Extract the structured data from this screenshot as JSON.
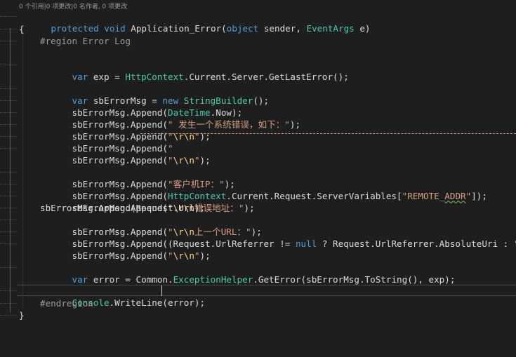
{
  "codelens": {
    "text": "0 个引用|0 项更改|0 名作者, 0 项更改"
  },
  "lines": {
    "l1": {
      "kw1": "protected",
      "kw2": "void",
      "name": " Application_Error(",
      "kw3": "object",
      "p1": " sender, ",
      "ty1": "EventArgs",
      "p2": " e)"
    },
    "l2": {
      "text": "{"
    },
    "l3": {
      "text": "#region Error Log"
    },
    "l4": {
      "kw": "var",
      "p1": " exp = ",
      "ty": "HttpContext",
      "p2": ".Current.Server.GetLastError();"
    },
    "l5": {
      "kw": "var",
      "p1": " sbErrorMsg = ",
      "kw2": "new",
      "sp": " ",
      "ty": "StringBuilder",
      "p2": "();"
    },
    "l6": {
      "p1": "sbErrorMsg.Append(",
      "ty": "DateTime",
      "p2": ".Now);"
    },
    "l7": {
      "p1": "sbErrorMsg.Append(",
      "st": "\" 发生一个系统错误，如下：\"",
      "p2": ");"
    },
    "l8": {
      "p1": "sbErrorMsg.Append(",
      "q1": "\"",
      "esc": "\\r\\n",
      "q2": "\"",
      "p2": ");"
    },
    "l9": {
      "p1": "sbErrorMsg.Append(",
      "st": "\""
    },
    "l10": {
      "p1": "sbErrorMsg.Append(",
      "q1": "\"",
      "esc": "\\r\\n",
      "q2": "\"",
      "p2": ");"
    },
    "l11": {
      "p1": "sbErrorMsg.Append(",
      "st": "\"客户机IP：\"",
      "p2": ");"
    },
    "l12": {
      "p1": "sbErrorMsg.Append(",
      "ty": "HttpContext",
      "p2": ".Current.Request.ServerVariables[",
      "st1": "\"REMOTE_",
      "st2": "ADDR",
      "st3": "\"",
      "p3": "]);"
    },
    "l13": {
      "p1": "sbErrorMsg.Append(",
      "q1": "\"",
      "esc": "\\r\\n",
      "st": "错误地址：\"",
      "p2": ");"
    },
    "l14": {
      "text": "sbErrorMsg.Append(Request.Url);"
    },
    "l15": {
      "p1": "sbErrorMsg.Append(",
      "q1": "\"",
      "esc": "\\r\\n",
      "st": "上一个URL：\"",
      "p2": ");"
    },
    "l16": {
      "p1": "sbErrorMsg.Append((Request.UrlReferrer != ",
      "kw": "null",
      "p2": " ? Request.UrlReferrer.AbsoluteUri : ",
      "st": "\"\"",
      "p3": "));"
    },
    "l17": {
      "p1": "sbErrorMsg.Append(",
      "q1": "\"",
      "esc": "\\r\\n",
      "q2": "\"",
      "p2": ");"
    },
    "l18": {
      "kw": "var",
      "p1": " error = Common.",
      "ty": "ExceptionHelper",
      "p2": ".GetError(sbErrorMsg.ToString(), exp);"
    },
    "l19": {
      "ty": "Console",
      "p1": ".WriteLine(error);"
    },
    "l20": {
      "text": "#endregion"
    },
    "l21": {
      "text": "}"
    }
  },
  "colors": {
    "background": "#1e1e1e",
    "keyword": "#569cd6",
    "type": "#4ec9b0",
    "string": "#d69d85",
    "preprocessor": "#9b9b9b",
    "text": "#dcdcdc"
  }
}
